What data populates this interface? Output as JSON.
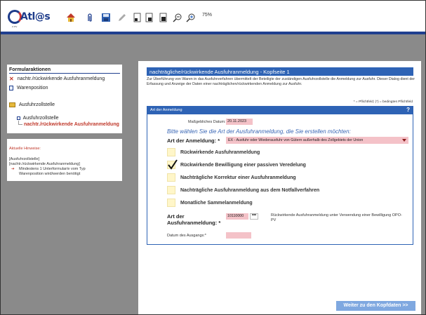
{
  "toolbar": {
    "zoom": "75%",
    "logo_text": "Atl@s",
    "logo_sub": "z.ev",
    "icons": [
      "home-icon",
      "attachment-icon",
      "save-icon",
      "edit-icon",
      "page-1-icon",
      "page-2-icon",
      "page-3-icon",
      "zoom-out-icon",
      "zoom-in-icon"
    ]
  },
  "sidebar": {
    "heading": "Formularaktionen",
    "items": [
      {
        "label": "nachtr./rückwirkende Ausfuhranmeldung",
        "icon": "red-x-icon"
      },
      {
        "label": "Warenposition",
        "icon": "document-icon"
      },
      {
        "label": "Ausfuhrzollstelle",
        "icon": "folder-icon"
      }
    ],
    "tree": {
      "parent": "Ausfuhrzollstelle",
      "child": "nachtr./rückwirkende Ausfuhranmeldung"
    }
  },
  "hints": {
    "title": "Aktuelle Hinweise:",
    "line1": "[Ausfuhrzollstelle]",
    "line2": "[nachtr./rückwirkende Ausfuhranmeldung]",
    "line3": "Mindestens 1 Unterformular/e vom Typ",
    "line4": "Warenposition wird/werden benötigt"
  },
  "main": {
    "title": "nachträgliche/rückwirkende Ausfuhranmeldung - Kopfseite 1",
    "description": "Zur Überführung von Waren in das Ausfuhrverfahren übermittelt der Beteiligte der zuständigen Ausfuhrzollstelle die Anmeldung zur Ausfuhr. Dieser Dialog dient der Erfassung und Anzeige der Daten einer nachträglichen/rückwirkenden Anmeldung zur Ausfuhr.",
    "required_note": "* = Pflichtfeld; (*) = bedingtes Pflichtfeld",
    "section_title": "Art der Anmeldung",
    "help": "?",
    "date_label": "Maßgebliches Datum: *",
    "date_value": "20.11.2023",
    "prompt": "Bitte wählen Sie die Art der Ausfuhranmeldung, die Sie erstellen möchten:",
    "art_label": "Art der Anmeldung: *",
    "art_select": "EX - Ausfuhr oder Wiederausfuhr von Gütern außerhalb des Zollgebiets der Union",
    "options": [
      {
        "label": "Rückwirkende Ausfuhranmeldung",
        "checked": false
      },
      {
        "label": "Rückwirkende Bewilligung einer passiven Veredelung",
        "checked": true
      },
      {
        "label": "Nachträgliche Korrektur einer Ausfuhranmeldung",
        "checked": false
      },
      {
        "label": "Nachträgliche Ausfuhranmeldung aus dem Notfallverfahren",
        "checked": false
      },
      {
        "label": "Monatliche Sammelanmeldung",
        "checked": false
      }
    ],
    "art2_label_line1": "Art der",
    "art2_label_line2": "Ausfuhranmeldung: *",
    "code_value": "10110000",
    "lookup_label": "•••",
    "code_description": "Rückwirkende Ausfuhranmeldung unter Verwendung einer Bewilligung OPO-PV",
    "exit_date_label": "Datum des Ausgangs:*",
    "next_button": "Weiter zu den Kopfdaten >>"
  }
}
